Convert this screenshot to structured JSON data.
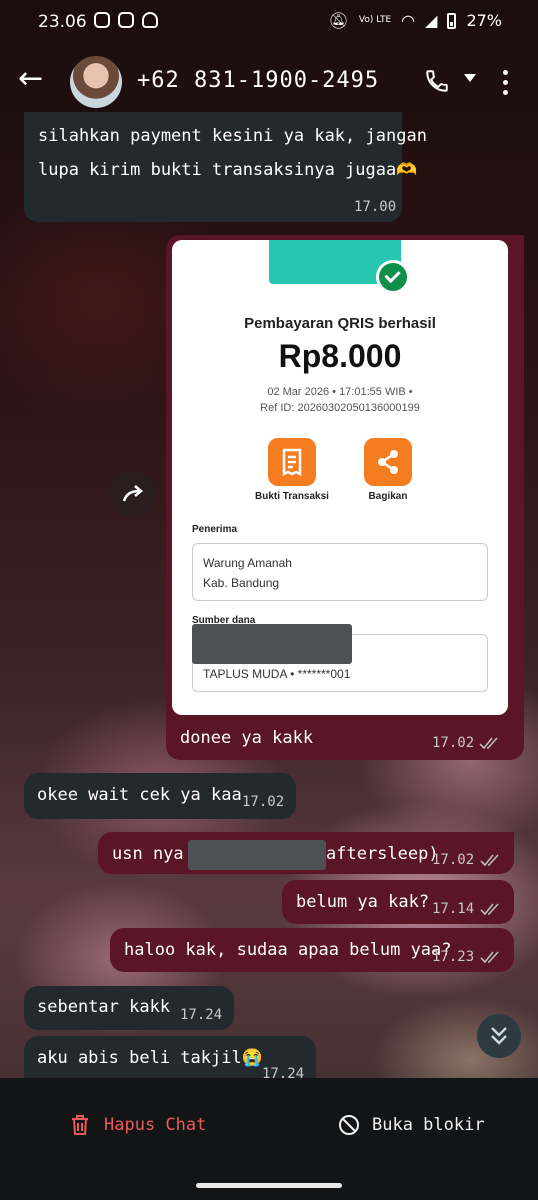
{
  "status_bar": {
    "time": "23.06",
    "battery": "27%",
    "network": "Vo) LTE"
  },
  "header": {
    "contact": "+62 831-1900-2495"
  },
  "messages": [
    {
      "id": "m1",
      "dir": "in",
      "lines": [
        "silahkan payment kesini ya kak, jangan",
        "lupa kirim bukti transaksinya jugaa🫶"
      ],
      "time": "17.00"
    },
    {
      "id": "m2",
      "dir": "out",
      "text": "donee ya kakk",
      "time": "17.02"
    },
    {
      "id": "m3",
      "dir": "in",
      "text": "okee wait cek ya kaa",
      "time": "17.02"
    },
    {
      "id": "m4",
      "dir": "out",
      "text_before": "usn nya",
      "text_after": "aftersleep)",
      "time": "17.02"
    },
    {
      "id": "m5",
      "dir": "out",
      "text": "belum ya kak?",
      "time": "17.14"
    },
    {
      "id": "m6",
      "dir": "out",
      "text": "haloo kak, sudaa apaa belum yaa?",
      "time": "17.23"
    },
    {
      "id": "m7",
      "dir": "in",
      "text": "sebentar kakk",
      "time": "17.24"
    },
    {
      "id": "m8",
      "dir": "in",
      "text": "aku abis beli takjil😭",
      "time": "17.24"
    }
  ],
  "receipt": {
    "title": "Pembayaran QRIS berhasil",
    "amount": "Rp8.000",
    "datetime": "02 Mar 2026 • 17:01:55 WIB •",
    "ref": "Ref ID: 20260302050136000199",
    "actions": [
      {
        "label": "Bukti Transaksi",
        "icon": "document-icon"
      },
      {
        "label": "Bagikan",
        "icon": "share-icon"
      }
    ],
    "recipient_label": "Penerima",
    "recipient_name": "Warung Amanah",
    "recipient_city": "Kab. Bandung",
    "source_label": "Sumber dana",
    "source_account": "TAPLUS MUDA • *******001"
  },
  "bottom_bar": {
    "delete_label": "Hapus Chat",
    "unblock_label": "Buka blokir"
  },
  "colors": {
    "outgoing_bubble": "#5a1526",
    "incoming_bubble": "#232a2d",
    "accent_orange": "#f57c1f",
    "delete_red": "#ea5a5a"
  }
}
